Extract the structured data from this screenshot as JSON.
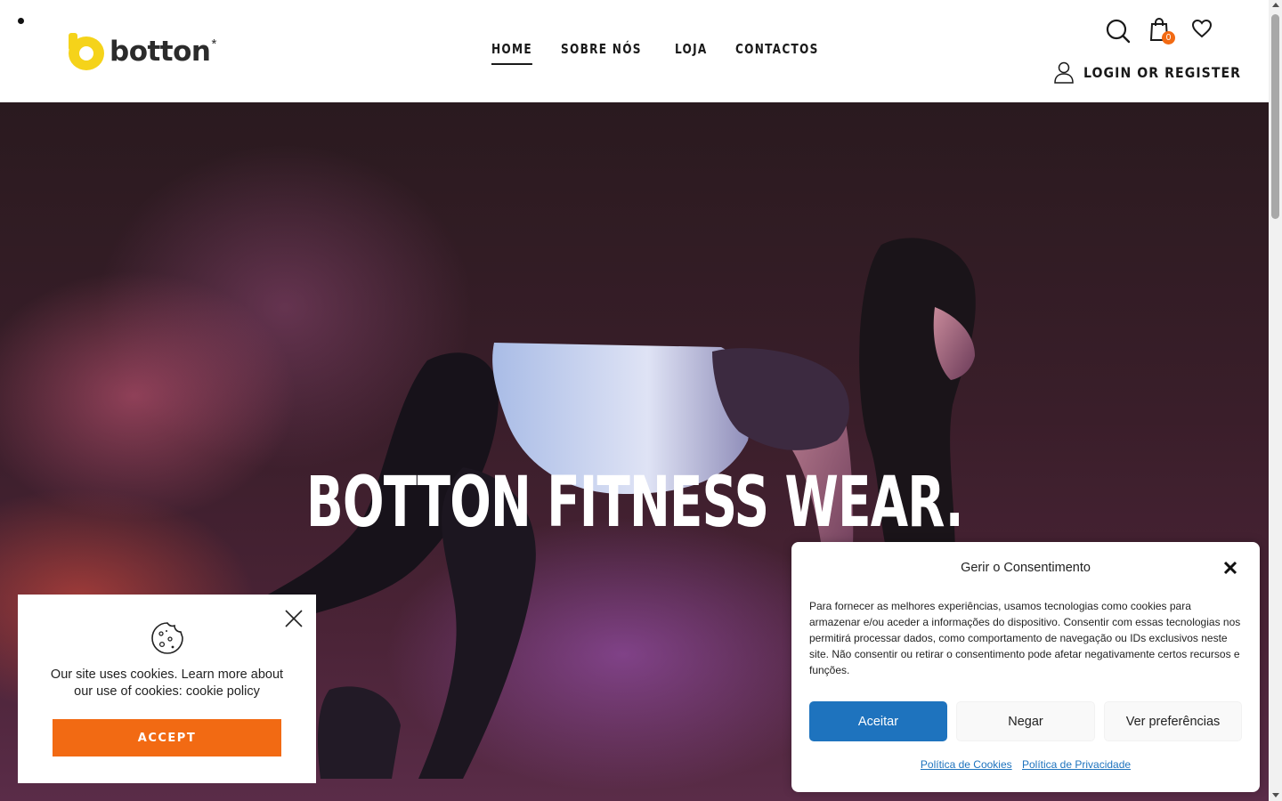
{
  "header": {
    "logo_text": "botton",
    "logo_star": "*",
    "nav": [
      {
        "label": "HOME",
        "active": true
      },
      {
        "label": "SOBRE NÓS",
        "active": false
      },
      {
        "label": "LOJA",
        "active": false
      },
      {
        "label": "CONTACTOS",
        "active": false
      }
    ],
    "cart_count": "0",
    "login_label": "LOGIN OR REGISTER",
    "icons": [
      "search-icon",
      "cart-icon",
      "heart-icon",
      "user-icon"
    ]
  },
  "hero": {
    "title": "BOTTON FITNESS WEAR."
  },
  "cookie_notice": {
    "text": "Our site uses cookies. Learn more about our use of cookies: cookie policy",
    "accept_label": "ACCEPT",
    "accent_color": "#f26a13"
  },
  "consent": {
    "title": "Gerir o Consentimento",
    "body": "Para fornecer as melhores experiências, usamos tecnologias como cookies para armazenar e/ou aceder a informações do dispositivo. Consentir com essas tecnologias nos permitirá processar dados, como comportamento de navegação ou IDs exclusivos neste site. Não consentir ou retirar o consentimento pode afetar negativamente certos recursos e funções.",
    "accept_label": "Aceitar",
    "deny_label": "Negar",
    "prefs_label": "Ver preferências",
    "cookie_policy_link": "Política de Cookies",
    "privacy_policy_link": "Política de Privacidade",
    "accent_color": "#1e73be"
  }
}
